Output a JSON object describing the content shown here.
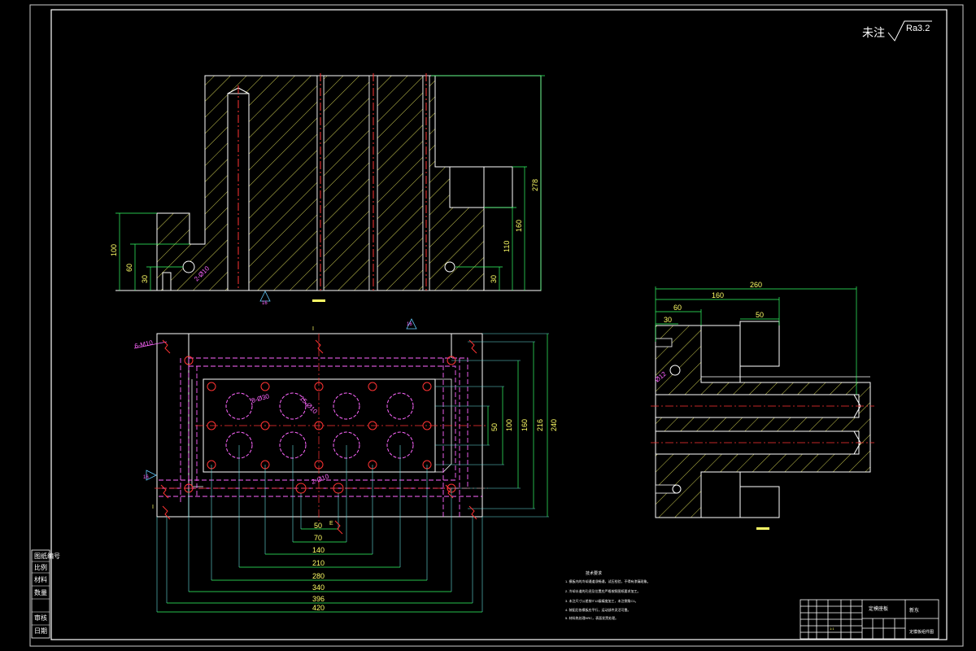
{
  "roughness": {
    "prefix": "未注",
    "value": "Ra3.2"
  },
  "front_view": {
    "dims_left": [
      "100",
      "60",
      "30"
    ],
    "dims_right": [
      "278",
      "160",
      "110",
      "30"
    ],
    "label_hole": "2-Ø10",
    "section_mark": "16"
  },
  "top_view": {
    "dims_bottom": [
      "50",
      "70",
      "140",
      "210",
      "280",
      "340",
      "396",
      "420"
    ],
    "dims_right": [
      "50",
      "100",
      "160",
      "216",
      "240"
    ],
    "labels": {
      "screws": "6-M10",
      "cavities": "8-Ø30",
      "runner": "15-Ø10",
      "channel": "2-Ø10",
      "sec_left": "16",
      "sec_top": "16",
      "cut_left": "I",
      "cut_right": "I",
      "cut_bottom": "E"
    }
  },
  "side_view": {
    "dims_top": [
      "260",
      "160",
      "60",
      "50",
      "30"
    ],
    "label_hole": "Ø12"
  },
  "notes": {
    "title": "技术要求",
    "items": [
      "1. 模板内的冷却通道须畅通，试压检验，不得有渗漏现象。",
      "2. 冷却水道的孔径及位置应严格按照图纸要求加工。",
      "3. 未注尺寸公差按IT12级精度加工，未注倒角C1。",
      "4. 装配后各模板应平行，运动部件灵活可靠。",
      "5. 材料热处理HRC，表面发黑处理。"
    ]
  },
  "title_block": {
    "part_name": "定模座板",
    "company": "新东",
    "drawing_name": "定模板组件图",
    "scale": "1:1"
  },
  "side_strip": [
    "图纸编号",
    "比例",
    "材料",
    "数量",
    "审核",
    "日期"
  ]
}
